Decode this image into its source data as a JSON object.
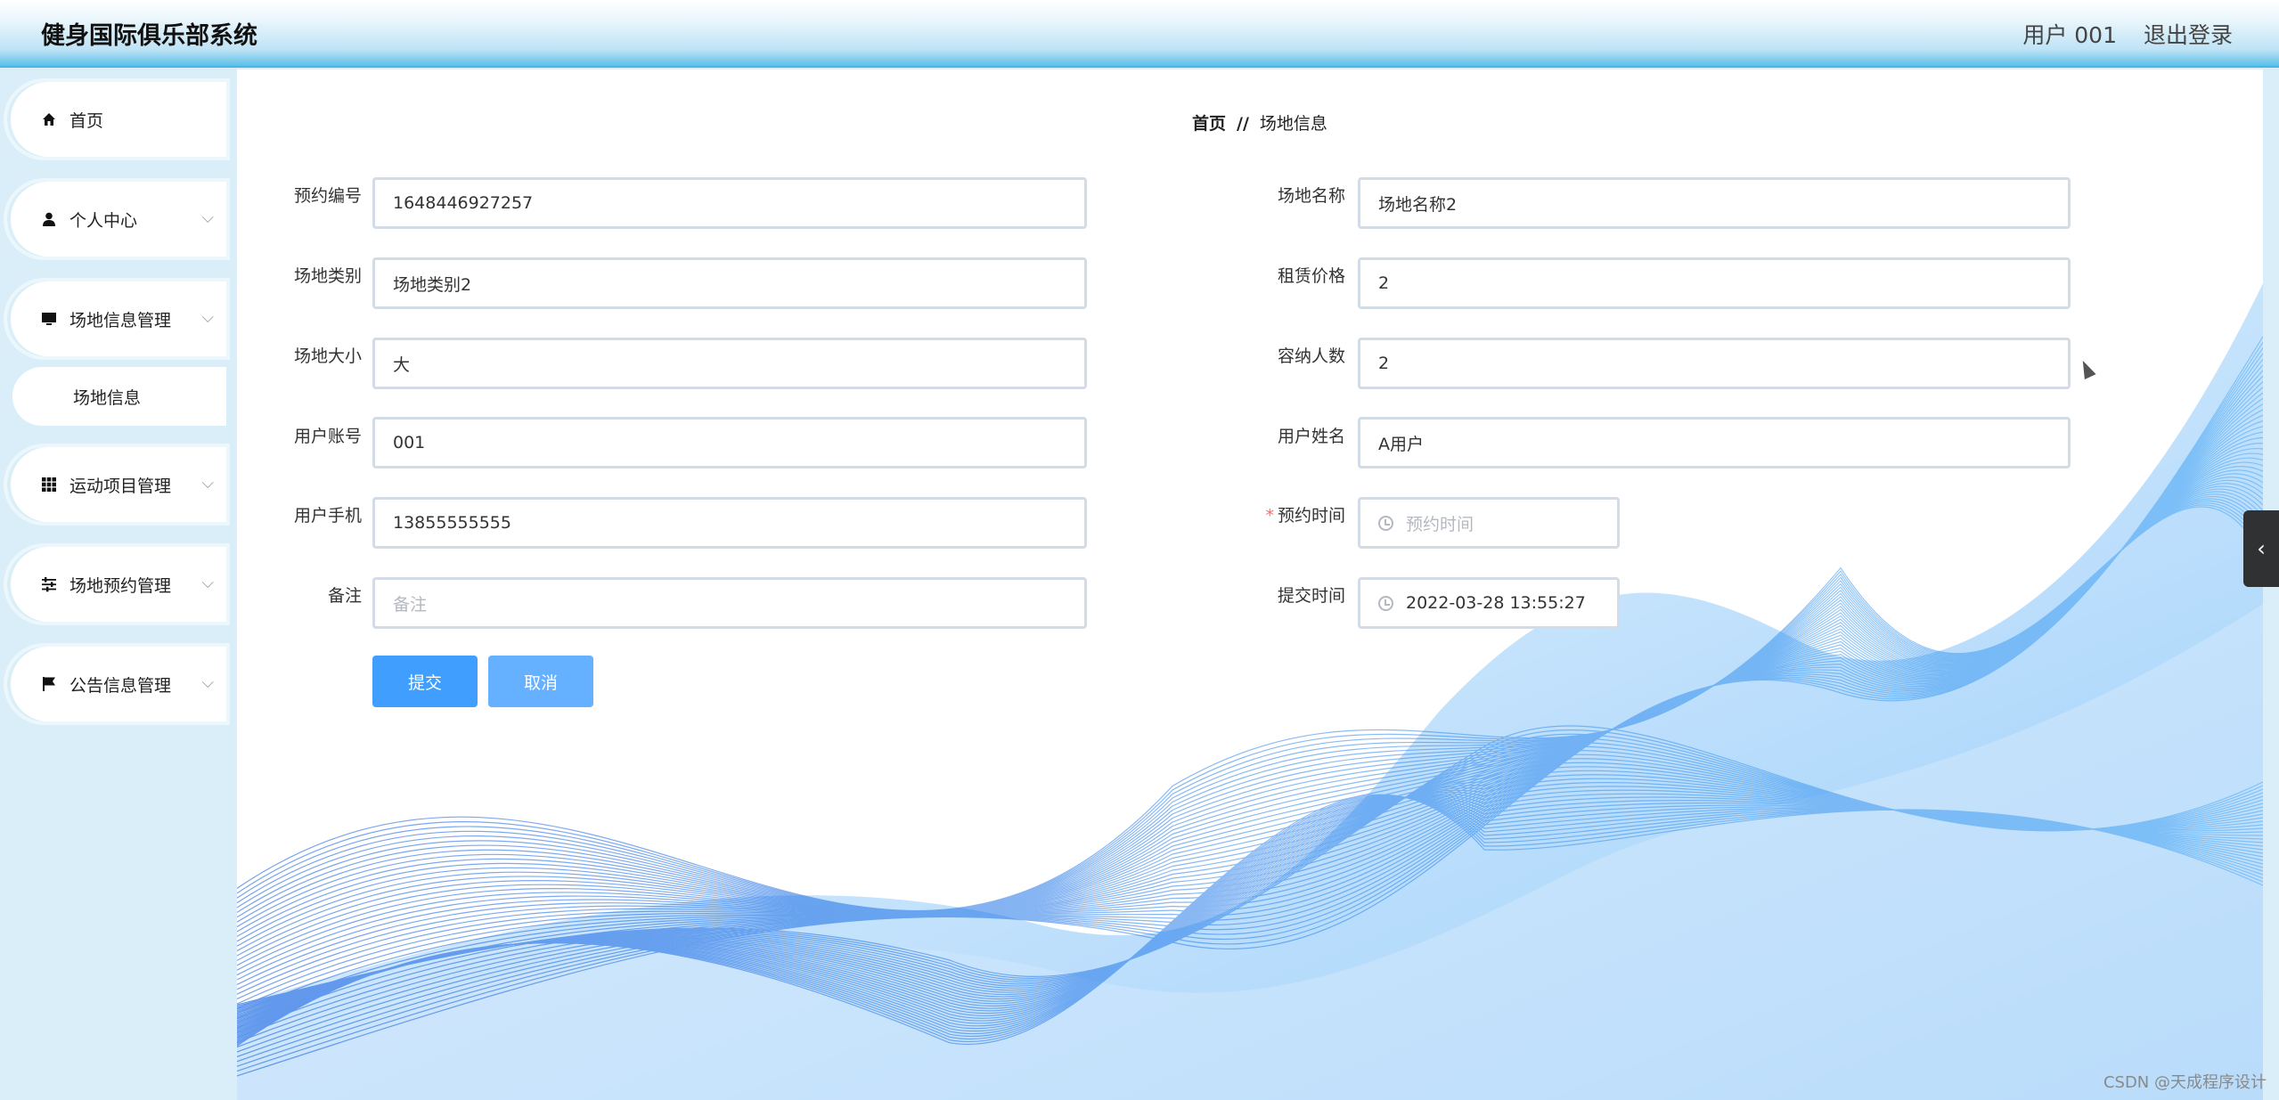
{
  "header": {
    "title": "健身国际俱乐部系统",
    "user": "用户 001",
    "logout": "退出登录"
  },
  "sidebar": {
    "items": [
      {
        "label": "首页",
        "icon": "home-icon"
      },
      {
        "label": "个人中心",
        "icon": "user-icon"
      },
      {
        "label": "场地信息管理",
        "icon": "monitor-icon"
      },
      {
        "label": "运动项目管理",
        "icon": "grid-icon"
      },
      {
        "label": "场地预约管理",
        "icon": "sliders-icon"
      },
      {
        "label": "公告信息管理",
        "icon": "flag-icon"
      }
    ],
    "submenu": {
      "label": "场地信息"
    }
  },
  "breadcrumb": {
    "home": "首页",
    "separator": "//",
    "current": "场地信息"
  },
  "form": {
    "booking_no": {
      "label": "预约编号",
      "value": "1648446927257"
    },
    "venue_name": {
      "label": "场地名称",
      "value": "场地名称2"
    },
    "venue_type": {
      "label": "场地类别",
      "value": "场地类别2"
    },
    "rent_price": {
      "label": "租赁价格",
      "value": "2"
    },
    "venue_size": {
      "label": "场地大小",
      "value": "大"
    },
    "capacity": {
      "label": "容纳人数",
      "value": "2"
    },
    "user_account": {
      "label": "用户账号",
      "value": "001"
    },
    "user_name": {
      "label": "用户姓名",
      "value": "A用户"
    },
    "user_phone": {
      "label": "用户手机",
      "value": "13855555555"
    },
    "booking_time": {
      "label": "预约时间",
      "required_mark": "*",
      "placeholder": "预约时间"
    },
    "remark": {
      "label": "备注",
      "placeholder": "备注"
    },
    "submit_time": {
      "label": "提交时间",
      "value": "2022-03-28 13:55:27"
    }
  },
  "buttons": {
    "submit": "提交",
    "cancel": "取消"
  },
  "side_tab": {
    "icon": "chevron-left-icon",
    "glyph": "‹"
  },
  "watermark": "CSDN @天成程序设计",
  "colors": {
    "primary": "#409eff",
    "cancel": "#66b1ff",
    "header_accent": "#45b6e6",
    "sidebar_bg": "#d9eef8",
    "wave": "#1a73e8"
  }
}
